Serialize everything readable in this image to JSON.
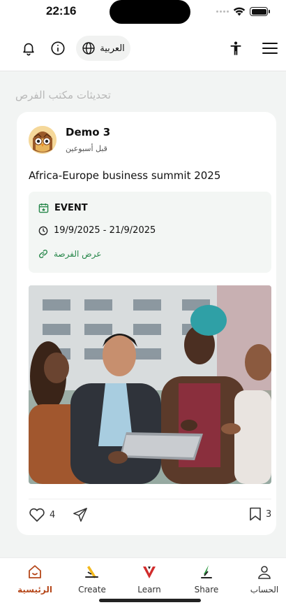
{
  "status_bar": {
    "time": "22:16"
  },
  "top_bar": {
    "language_label": "العربية",
    "icons": [
      "bell-icon",
      "info-icon",
      "globe-icon",
      "accessibility-icon",
      "menu-icon"
    ]
  },
  "feed": {
    "section_title": "تحديثات مكتب الفرص",
    "post": {
      "author": "Demo 3",
      "time_ago": "قبل أسبوعين",
      "title": "Africa-Europe business summit 2025",
      "event": {
        "type_label": "EVENT",
        "date_range": "19/9/2025 - 21/9/2025",
        "link_label": "عرض الفرصة"
      },
      "likes": "4",
      "bookmarks": "3"
    }
  },
  "bottom_nav": {
    "items": [
      {
        "label": "الرئيسية",
        "icon": "home-icon",
        "active": true
      },
      {
        "label": "Create",
        "icon": "create-icon"
      },
      {
        "label": "Learn",
        "icon": "learn-icon"
      },
      {
        "label": "Share",
        "icon": "share-icon"
      },
      {
        "label": "الحساب",
        "icon": "account-icon"
      }
    ]
  },
  "colors": {
    "accent": "#b5471a",
    "link_green": "#27874a"
  }
}
